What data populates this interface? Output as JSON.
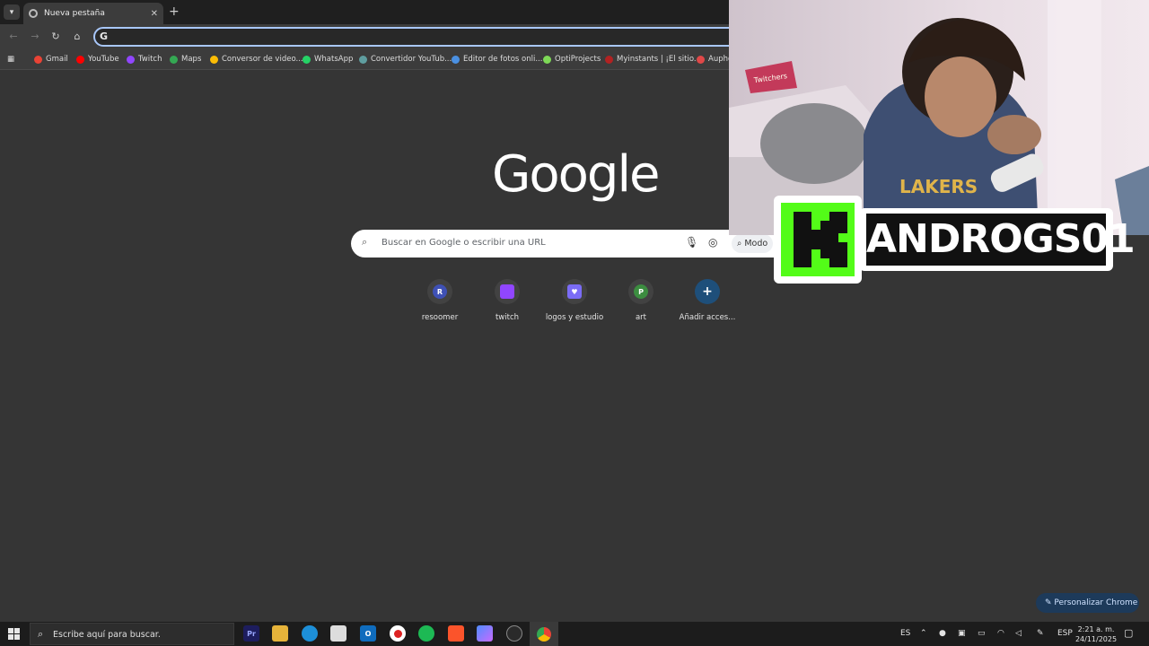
{
  "browser": {
    "active_tab_title": "Nueva pestaña",
    "new_tab_symbol": "+",
    "close_symbol": "✕",
    "omnibox_value": ""
  },
  "bookmarks": [
    {
      "label": "Gmail",
      "color": "#ea4335"
    },
    {
      "label": "YouTube",
      "color": "#ff0000"
    },
    {
      "label": "Twitch",
      "color": "#9146ff"
    },
    {
      "label": "Maps",
      "color": "#34a853"
    },
    {
      "label": "Conversor de video...",
      "color": "#fbbc05"
    },
    {
      "label": "WhatsApp",
      "color": "#25d366"
    },
    {
      "label": "Convertidor YouTub...",
      "color": "#5f9ea0"
    },
    {
      "label": "Editor de fotos onli...",
      "color": "#4a90e2"
    },
    {
      "label": "OptiProjects",
      "color": "#7ed957"
    },
    {
      "label": "Myinstants | ¡El sitio...",
      "color": "#b22222"
    },
    {
      "label": "Aupho",
      "color": "#e04848"
    }
  ],
  "ntp": {
    "logo": "Google",
    "search_placeholder": "Buscar en Google o escribir una URL",
    "mode_label": "Modo",
    "shortcuts": [
      {
        "label": "resoomer",
        "letter": "R",
        "color": "#3f51b5"
      },
      {
        "label": "twitch",
        "letter": "",
        "color": "#9146ff"
      },
      {
        "label": "logos y estudio",
        "letter": "",
        "color": "#7b6cf6"
      },
      {
        "label": "art",
        "letter": "P",
        "color": "#3c8d40"
      },
      {
        "label": "Añadir acces...",
        "letter": "+",
        "color": "#1e4f7a"
      }
    ],
    "customize_label": "Personalizar Chrome"
  },
  "overlay": {
    "badge_letter": "K",
    "streamer_name": "ANDROGS01",
    "accent": "#53fc18"
  },
  "taskbar": {
    "search_text": "Escribe aquí para buscar.",
    "lang_short": "ES",
    "lang_long": "ESP",
    "time": "2:21 a. m.",
    "date": "24/11/2025"
  }
}
